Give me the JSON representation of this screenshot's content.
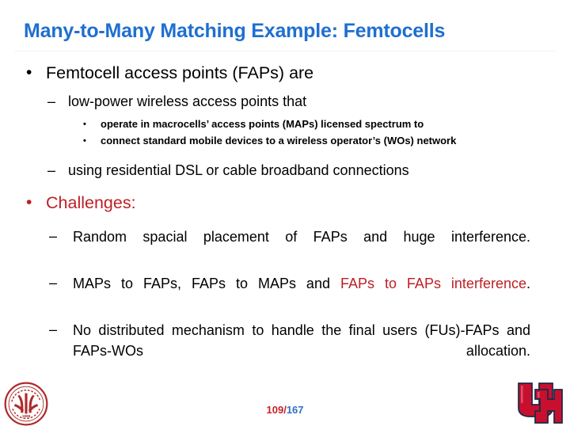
{
  "slide": {
    "title": "Many-to-Many Matching Example: Femtocells",
    "title_color": "#1F6FD0",
    "accent_red": "#BD2026",
    "background": "#FFFFFF"
  },
  "content": {
    "bullet1": {
      "marker": "•",
      "text": "Femtocell access points (FAPs) are"
    },
    "sub1": {
      "marker": "–",
      "text": "low-power wireless access points that"
    },
    "subsub1": {
      "marker": "•",
      "text": "operate in macrocells’ access points (MAPs) licensed spectrum to"
    },
    "subsub2": {
      "marker": "•",
      "text": "connect standard mobile devices to a wireless operator’s (WOs) network"
    },
    "sub2": {
      "marker": "–",
      "text": "using residential DSL or cable broadband connections"
    },
    "bullet2": {
      "marker": "•",
      "text": "Challenges:",
      "color": "#BD2026"
    },
    "challenge1": {
      "marker": "–",
      "text": "Random spacial placement of FAPs and huge interference."
    },
    "challenge2": {
      "marker": "–",
      "text_plain": "MAPs to FAPs, FAPs to MAPs and ",
      "text_red": "FAPs to FAPs interference",
      "text_tail": "."
    },
    "challenge3": {
      "marker": "–",
      "text": "No distributed mechanism to handle the final users (FUs)-FAPs and FAPs-WOs allocation."
    }
  },
  "footer": {
    "page_current": "109",
    "page_separator": "/",
    "page_total": "167"
  },
  "logos": {
    "left": {
      "name": "peking-university-seal",
      "top_text": "PEKING UNIVERSITY",
      "year": "1898",
      "color": "#AE2B2B"
    },
    "right": {
      "name": "university-of-houston-logo",
      "letters": "UH",
      "color": "#C8102E"
    }
  }
}
